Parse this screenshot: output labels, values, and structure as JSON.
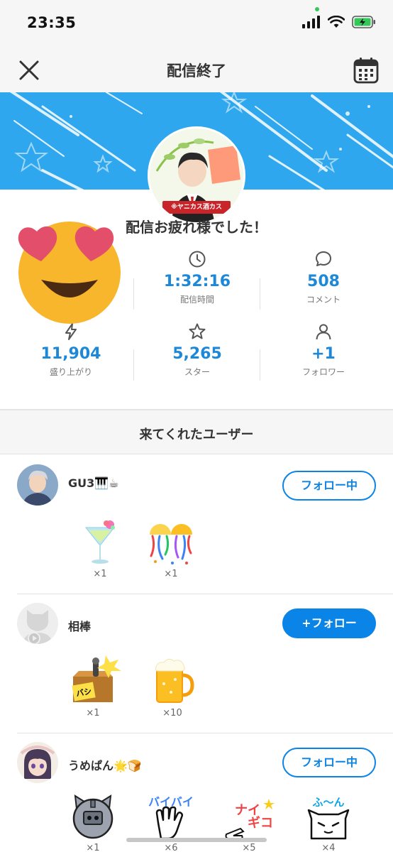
{
  "status_bar": {
    "time": "23:35"
  },
  "nav": {
    "title": "配信終了"
  },
  "profile": {
    "avatar_caption": "※ヤニカス酒カス"
  },
  "greeting": "配信お疲れ様でした！",
  "stats": [
    {
      "icon": "clock-icon",
      "value": "1:32:16",
      "label": "配信時間"
    },
    {
      "icon": "comment-icon",
      "value": "508",
      "label": "コメント"
    },
    {
      "icon": "bolt-icon",
      "value": "11,904",
      "label": "盛り上がり"
    },
    {
      "icon": "star-icon",
      "value": "5,265",
      "label": "スター"
    },
    {
      "icon": "person-icon",
      "value": "+1",
      "label": "フォロワー"
    }
  ],
  "section": {
    "title": "来てくれたユーザー"
  },
  "users": [
    {
      "name": "GU3🎹☕",
      "follow_label": "フォロー中",
      "follow_state": "following",
      "gifts": [
        {
          "icon": "cocktail-icon",
          "count": "×1"
        },
        {
          "icon": "party-balloon-icon",
          "count": "×1"
        }
      ]
    },
    {
      "name": "相棒",
      "follow_label": "+フォロー",
      "follow_state": "not-following",
      "gifts": [
        {
          "icon": "slap-stamp-icon",
          "count": "×1"
        },
        {
          "icon": "beer-mug-icon",
          "count": "×10"
        }
      ]
    },
    {
      "name": "うめぱん🌟🍞",
      "follow_label": "フォロー中",
      "follow_state": "following",
      "gifts": [
        {
          "icon": "robot-cat-icon",
          "count": "×1"
        },
        {
          "icon": "byebye-hand-icon",
          "count": "×6"
        },
        {
          "icon": "nice-pointing-icon",
          "count": "×5"
        },
        {
          "icon": "fun-cat-icon",
          "count": "×4"
        }
      ]
    }
  ],
  "colors": {
    "accent": "#0b84e8",
    "banner": "#2ea7ef",
    "stat_value": "#1e88d8"
  }
}
